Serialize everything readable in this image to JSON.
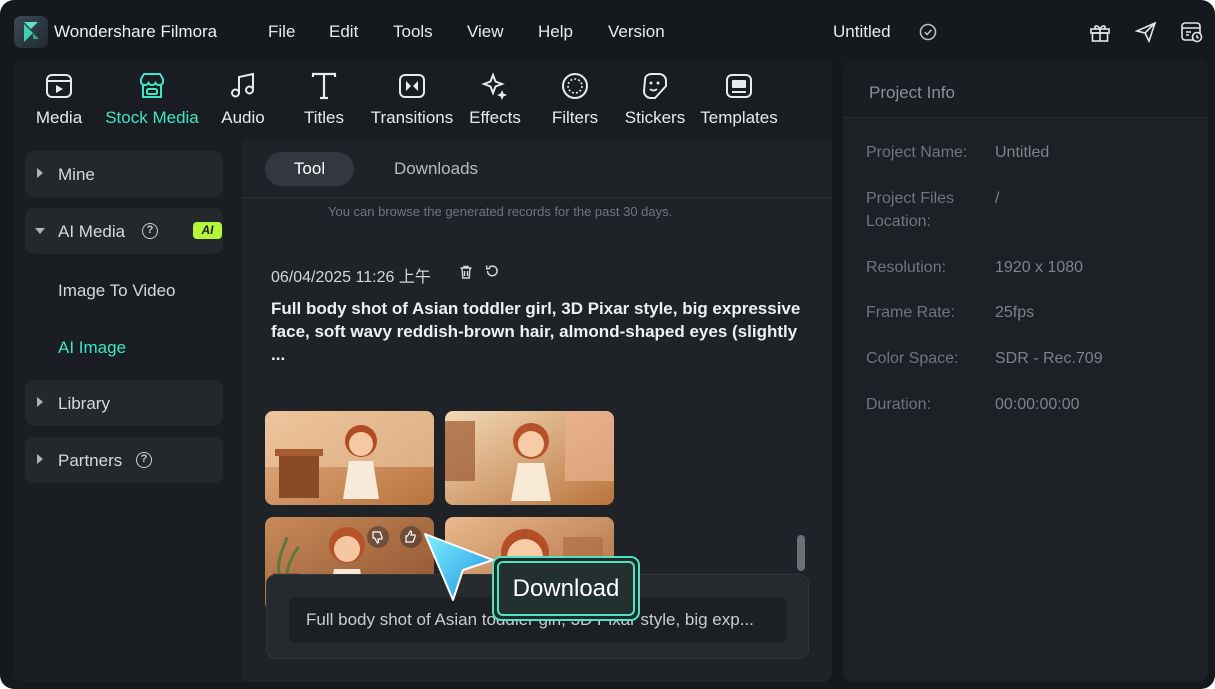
{
  "app": {
    "name": "Wondershare Filmora",
    "project_title": "Untitled"
  },
  "menu": [
    "File",
    "Edit",
    "Tools",
    "View",
    "Help",
    "Version"
  ],
  "tabs": [
    {
      "label": "Media",
      "icon": "media-icon"
    },
    {
      "label": "Stock Media",
      "icon": "stock-media-icon",
      "active": true
    },
    {
      "label": "Audio",
      "icon": "music-note-icon"
    },
    {
      "label": "Titles",
      "icon": "text-t-icon"
    },
    {
      "label": "Transitions",
      "icon": "transition-icon"
    },
    {
      "label": "Effects",
      "icon": "sparkle-icon"
    },
    {
      "label": "Filters",
      "icon": "filter-icon"
    },
    {
      "label": "Stickers",
      "icon": "sticker-icon"
    },
    {
      "label": "Templates",
      "icon": "template-icon"
    }
  ],
  "sidebar": {
    "mine": "Mine",
    "ai_media": "AI Media",
    "ai_badge": "AI",
    "image_to_video": "Image To Video",
    "ai_image": "AI Image",
    "library": "Library",
    "partners": "Partners",
    "help_glyph": "?"
  },
  "content": {
    "seg_tool": "Tool",
    "seg_downloads": "Downloads",
    "hint": "You can browse the generated records for the past 30 days.",
    "record_date": "06/04/2025 11:26 上午",
    "record_prompt": "Full body shot of Asian toddler girl, 3D Pixar style, big expressive face, soft wavy reddish-brown hair, almond-shaped eyes (slightly ...",
    "input_text": "Full body shot of Asian toddler girl, 3D Pixar style, big exp..."
  },
  "project_info": {
    "title": "Project Info",
    "rows": [
      {
        "label": "Project Name:",
        "value": "Untitled"
      },
      {
        "label": "Project Files Location:",
        "value": "/"
      },
      {
        "label": "Resolution:",
        "value": "1920 x 1080"
      },
      {
        "label": "Frame Rate:",
        "value": "25fps"
      },
      {
        "label": "Color Space:",
        "value": "SDR - Rec.709"
      },
      {
        "label": "Duration:",
        "value": "00:00:00:00"
      }
    ]
  },
  "tooltip": {
    "label": "Download"
  },
  "colors": {
    "accent": "#3fe6c6",
    "ai_badge": "#b6f53a",
    "tooltip_border": "#4fe3c2"
  }
}
